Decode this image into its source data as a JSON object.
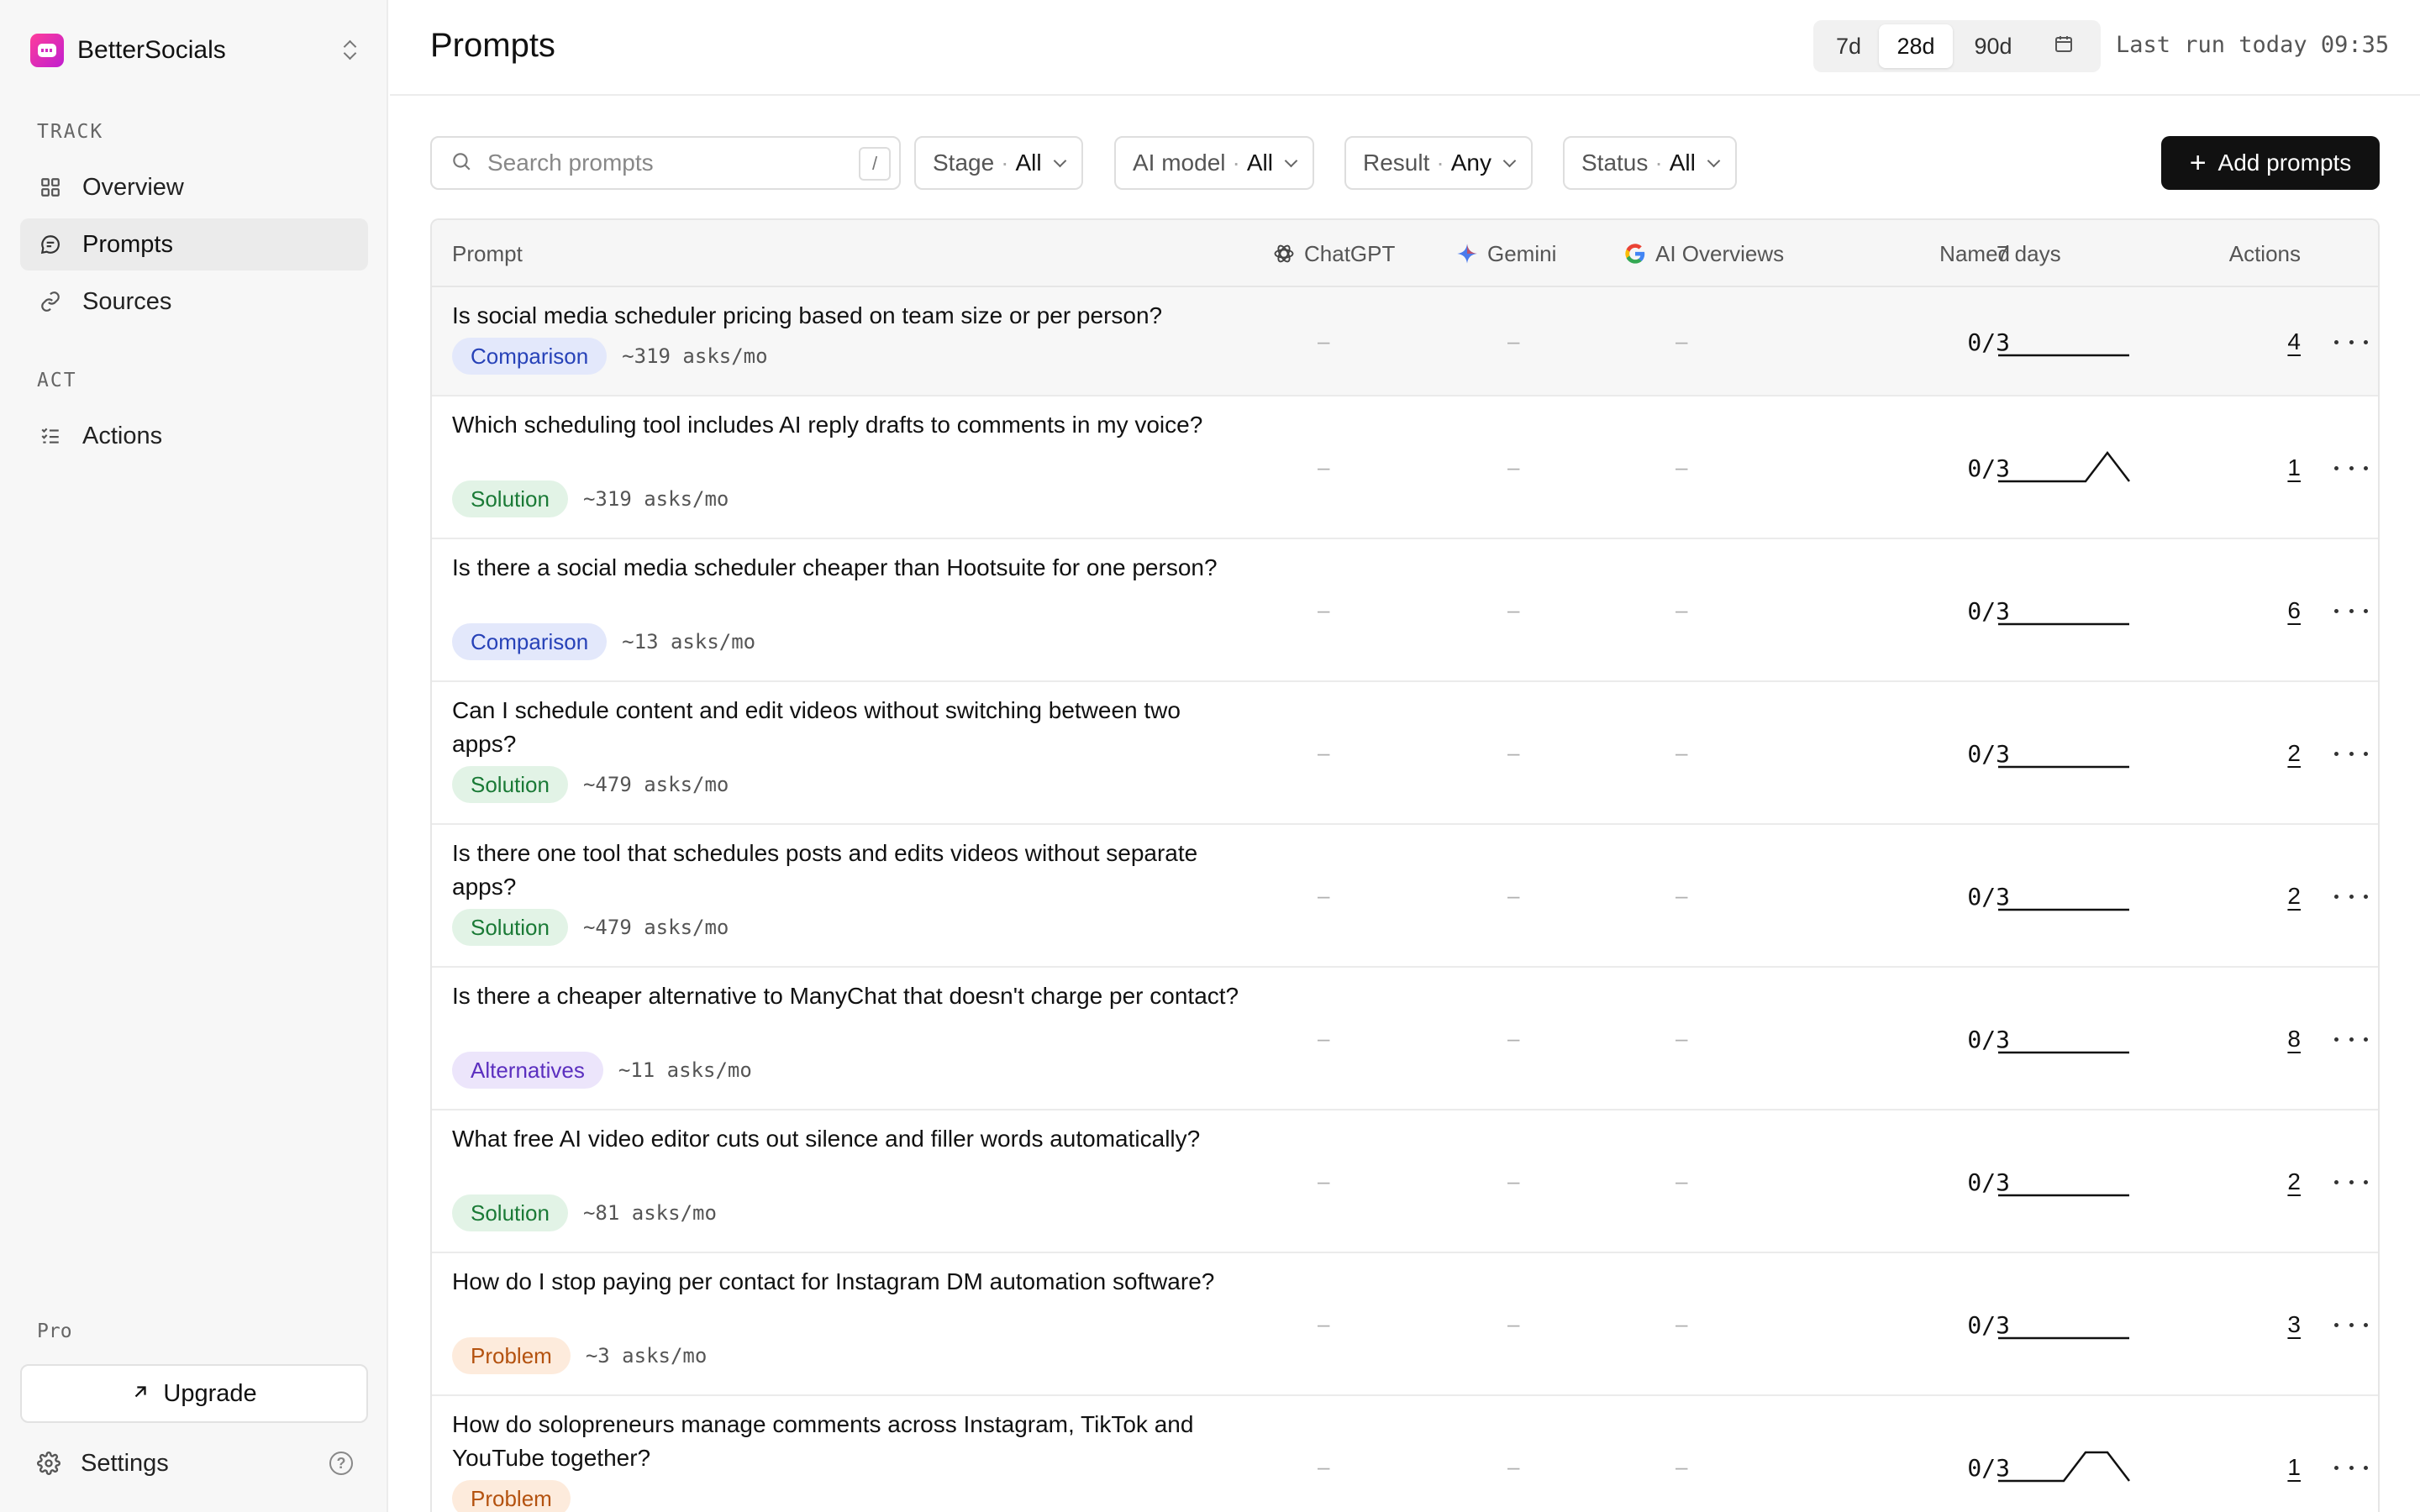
{
  "sidebar": {
    "workspace_name": "BetterSocials",
    "sections": [
      {
        "label": "TRACK",
        "items": [
          {
            "label": "Overview",
            "icon": "grid-icon",
            "active": false
          },
          {
            "label": "Prompts",
            "icon": "chat-icon",
            "active": true
          },
          {
            "label": "Sources",
            "icon": "link-icon",
            "active": false
          }
        ]
      },
      {
        "label": "ACT",
        "items": [
          {
            "label": "Actions",
            "icon": "checklist-icon",
            "active": false
          }
        ]
      }
    ],
    "plan_label": "Pro",
    "upgrade_label": "Upgrade",
    "settings_label": "Settings",
    "help_glyph": "?"
  },
  "header": {
    "title": "Prompts",
    "ranges": [
      "7d",
      "28d",
      "90d"
    ],
    "active_range": "28d",
    "last_run": "Last run today 09:35"
  },
  "filters": {
    "search_placeholder": "Search prompts",
    "search_shortcut": "/",
    "items": [
      {
        "label": "Stage",
        "value": "All"
      },
      {
        "label": "AI model",
        "value": "All"
      },
      {
        "label": "Result",
        "value": "Any"
      },
      {
        "label": "Status",
        "value": "All"
      }
    ],
    "add_label": "Add prompts"
  },
  "table": {
    "columns": {
      "prompt": "Prompt",
      "chatgpt": "ChatGPT",
      "gemini": "Gemini",
      "ai_overviews": "AI Overviews",
      "named": "Named",
      "trend": "7 days",
      "actions": "Actions"
    },
    "empty_cell": "–",
    "rows": [
      {
        "prompt": "Is social media scheduler pricing based on team size or per person?",
        "tag": "Comparison",
        "tag_type": "comparison",
        "asks": "~319 asks/mo",
        "named": "0/3",
        "actions": "4",
        "trend": [
          0,
          0,
          0,
          0,
          0,
          0,
          0
        ]
      },
      {
        "prompt": "Which scheduling tool includes AI reply drafts to comments in my voice?",
        "tag": "Solution",
        "tag_type": "solution",
        "asks": "~319 asks/mo",
        "named": "0/3",
        "actions": "1",
        "trend": [
          0,
          0,
          0,
          0,
          0,
          1,
          0
        ]
      },
      {
        "prompt": "Is there a social media scheduler cheaper than Hootsuite for one person?",
        "tag": "Comparison",
        "tag_type": "comparison",
        "asks": "~13 asks/mo",
        "named": "0/3",
        "actions": "6",
        "trend": [
          0,
          0,
          0,
          0,
          0,
          0,
          0
        ]
      },
      {
        "prompt": "Can I schedule content and edit videos without switching between two apps?",
        "tag": "Solution",
        "tag_type": "solution",
        "asks": "~479 asks/mo",
        "named": "0/3",
        "actions": "2",
        "trend": [
          0,
          0,
          0,
          0,
          0,
          0,
          0
        ]
      },
      {
        "prompt": "Is there one tool that schedules posts and edits videos without separate apps?",
        "tag": "Solution",
        "tag_type": "solution",
        "asks": "~479 asks/mo",
        "named": "0/3",
        "actions": "2",
        "trend": [
          0,
          0,
          0,
          0,
          0,
          0,
          0
        ]
      },
      {
        "prompt": "Is there a cheaper alternative to ManyChat that doesn't charge per contact?",
        "tag": "Alternatives",
        "tag_type": "alternatives",
        "asks": "~11 asks/mo",
        "named": "0/3",
        "actions": "8",
        "trend": [
          0,
          0,
          0,
          0,
          0,
          0,
          0
        ]
      },
      {
        "prompt": "What free AI video editor cuts out silence and filler words automatically?",
        "tag": "Solution",
        "tag_type": "solution",
        "asks": "~81 asks/mo",
        "named": "0/3",
        "actions": "2",
        "trend": [
          0,
          0,
          0,
          0,
          0,
          0,
          0
        ]
      },
      {
        "prompt": "How do I stop paying per contact for Instagram DM automation software?",
        "tag": "Problem",
        "tag_type": "problem",
        "asks": "~3 asks/mo",
        "named": "0/3",
        "actions": "3",
        "trend": [
          0,
          0,
          0,
          0,
          0,
          0,
          0
        ]
      },
      {
        "prompt": "How do solopreneurs manage comments across Instagram, TikTok and YouTube together?",
        "tag": "Problem",
        "tag_type": "problem",
        "asks": "",
        "named": "0/3",
        "actions": "1",
        "trend": [
          0,
          0,
          0,
          0,
          1,
          1,
          0
        ]
      }
    ]
  }
}
